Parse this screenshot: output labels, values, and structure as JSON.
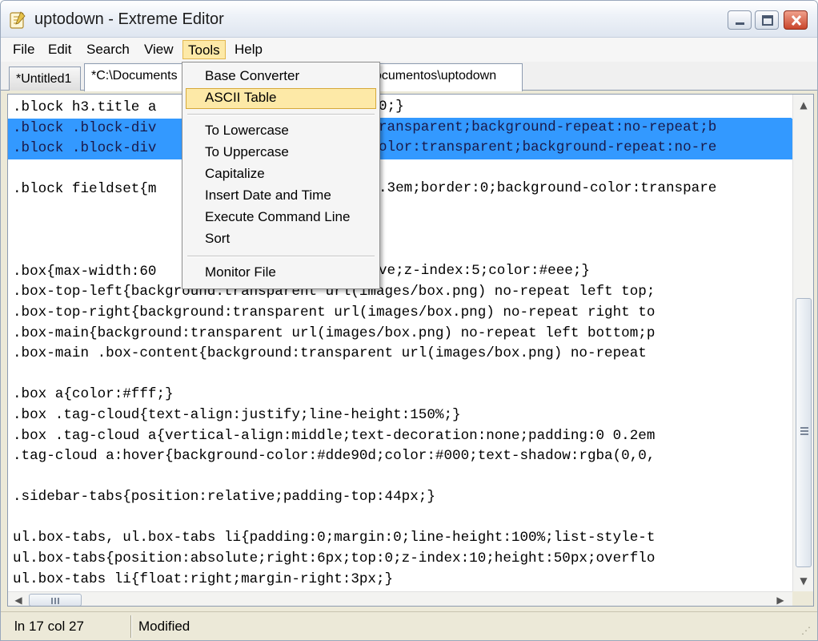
{
  "window": {
    "title": "uptodown - Extreme Editor"
  },
  "menu": [
    "File",
    "Edit",
    "Search",
    "View",
    "Tools",
    "Help"
  ],
  "tabs": [
    "*Untitled1",
    "*C:\\Documents",
    "ocumentos\\uptodown"
  ],
  "tools_menu": {
    "items": [
      "Base Converter",
      "ASCII Table",
      "To Lowercase",
      "To Uppercase",
      "Capitalize",
      "Insert Date and Time",
      "Execute Command Line",
      "Sort",
      "Monitor File"
    ],
    "highlighted": "ASCII Table"
  },
  "code": [
    ".block h3.title a",
    ".block .block-div",
    ".block .block-div",
    "",
    ".block fieldset{m",
    "",
    "",
    "",
    ".box{max-width:60",
    ".box-top-left{background:transparent url(images/box.png) no-repeat left top;",
    ".box-top-right{background:transparent url(images/box.png) no-repeat right to",
    ".box-main{background:transparent url(images/box.png) no-repeat left bottom;p",
    ".box-main .box-content{background:transparent url(images/box.png) no-repeat",
    "",
    ".box a{color:#fff;}",
    ".box .tag-cloud{text-align:justify;line-height:150%;}",
    ".box .tag-cloud a{vertical-align:middle;text-decoration:none;padding:0 0.2em",
    ".tag-cloud a:hover{background-color:#dde90d;color:#000;text-shadow:rgba(0,0,",
    "",
    ".sidebar-tabs{position:relative;padding-top:44px;}",
    "",
    "ul.box-tabs, ul.box-tabs li{padding:0;margin:0;line-height:100%;list-style-t",
    "ul.box-tabs{position:absolute;right:6px;top:0;z-index:10;height:50px;overflo",
    "ul.box-tabs li{float:right;margin-right:3px;}"
  ],
  "code_right": [
    "0;}",
    "ransparent;background-repeat:no-repeat;b",
    "olor:transparent;background-repeat:no-re",
    "",
    ".3em;border:0;background-color:transpare",
    "",
    "",
    "",
    "ve;z-index:5;color:#eee;}"
  ],
  "status": {
    "position": "ln 17 col 27",
    "state": "Modified"
  },
  "colors": {
    "selection": "#3399ff",
    "menu_highlight": "#fde9a7"
  }
}
